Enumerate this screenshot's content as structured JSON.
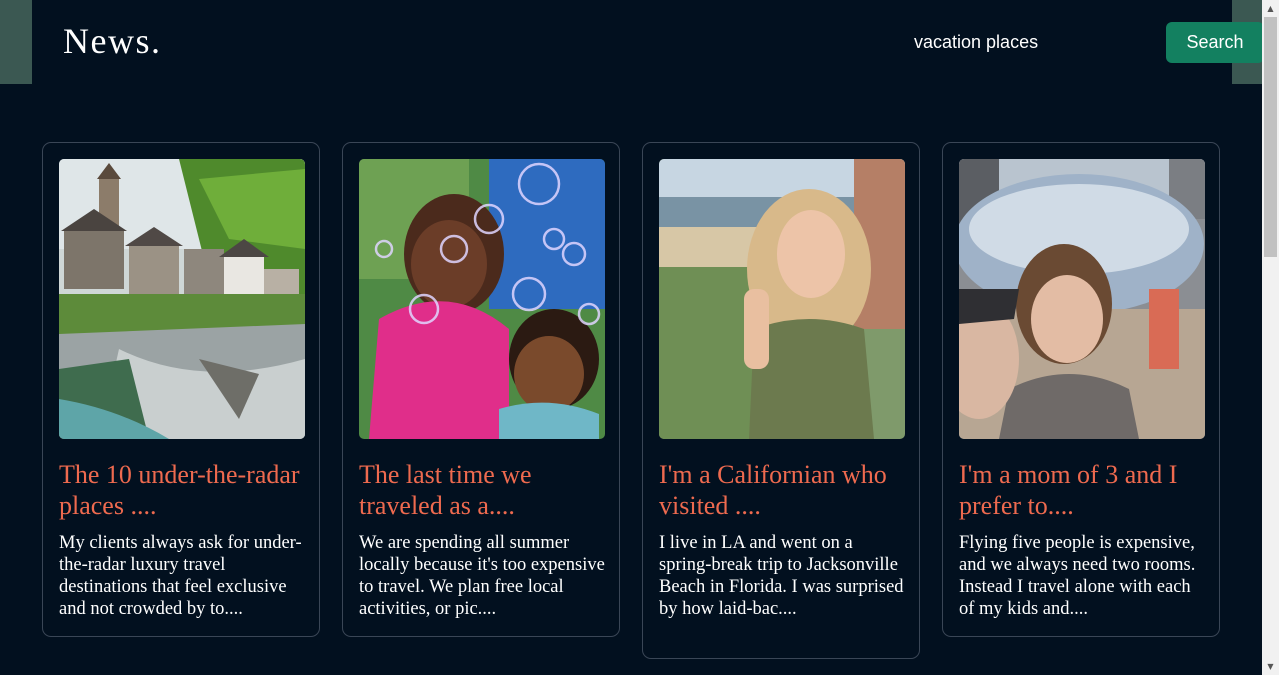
{
  "header": {
    "logo": "News.",
    "search_value": "vacation places",
    "search_button": "Search"
  },
  "cards": [
    {
      "image": "village-by-river-photo",
      "title": "The 10 under-the-radar places ....",
      "description": "My clients always ask for under-the-radar luxury travel destinations that feel exclusive and not crowded by to...."
    },
    {
      "image": "kids-blowing-bubbles-photo",
      "title": "The last time we traveled as a....",
      "description": "We are spending all summer locally because it's too expensive to travel. We plan free local activities, or pic...."
    },
    {
      "image": "woman-at-beach-photo",
      "title": "I'm a Californian who visited ....",
      "description": "I live in LA and went on a spring-break trip to Jacksonville Beach in Florida. I was surprised by how laid-bac...."
    },
    {
      "image": "mother-son-selfie-photo",
      "title": "I'm a mom of 3 and I prefer to....",
      "description": "Flying five people is expensive, and we always need two rooms. Instead I travel alone with each of my kids and...."
    }
  ],
  "colors": {
    "background": "#02101f",
    "accent_button": "#138060",
    "title_text": "#ee6a4f",
    "card_border": "#3a4656"
  }
}
